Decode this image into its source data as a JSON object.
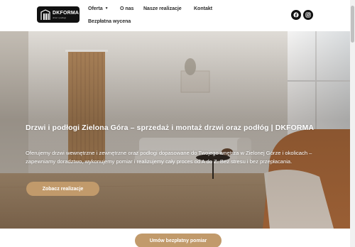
{
  "header": {
    "logo": {
      "title": "DKFORMA",
      "subtitle": "drzwi i podłogi"
    },
    "nav": {
      "oferta": "Oferta",
      "o_nas": "O nas",
      "realizacje": "Nasze realizacje",
      "kontakt": "Kontakt",
      "wycena": "Bezpłatna wycena"
    },
    "social": {
      "facebook_icon": "facebook-icon",
      "instagram_icon": "instagram-icon"
    }
  },
  "hero": {
    "title": "Drzwi i podłogi Zielona Góra – sprzedaż i montaż drzwi oraz podłóg | DKFORMA",
    "text": "Oferujemy drzwi wewnętrzne i zewnętrzne oraz podłogi dopasowane do Twojego wnętrza w Zielonej Górze i okolicach – zapewniamy doradztwo, wykonujemy pomiar i realizujemy cały proces od A do Z. Bez stresu i bez przepłacania.",
    "cta": "Zobacz realizacje"
  },
  "bottom": {
    "cta": "Umów bezpłatny pomiar"
  },
  "colors": {
    "accent": "#c19a6b",
    "dark": "#111111",
    "text": "#2b2b2b"
  }
}
